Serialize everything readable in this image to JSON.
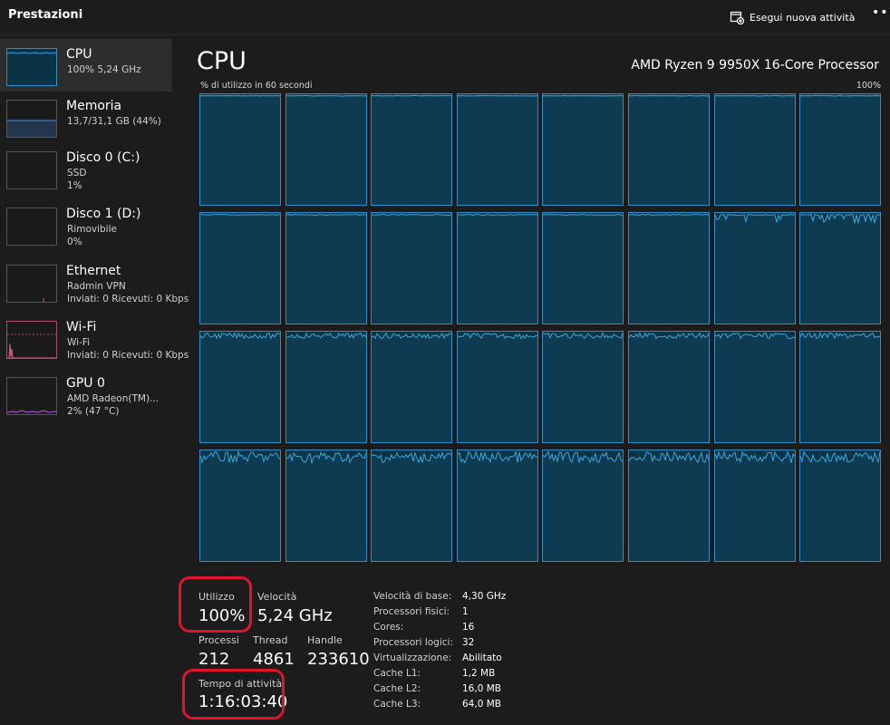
{
  "window": {
    "title": "Prestazioni",
    "run_task_label": "Esegui nuova attività",
    "more_label": "•••"
  },
  "sidebar": {
    "items": [
      {
        "name": "CPU",
        "sub1": "100% 5,24 GHz",
        "sub2": ""
      },
      {
        "name": "Memoria",
        "sub1": "13,7/31,1 GB (44%)",
        "sub2": ""
      },
      {
        "name": "Disco 0 (C:)",
        "sub1": "SSD",
        "sub2": "1%"
      },
      {
        "name": "Disco 1 (D:)",
        "sub1": "Rimovibile",
        "sub2": "0%"
      },
      {
        "name": "Ethernet",
        "sub1": "Radmin VPN",
        "sub2": "Inviati: 0 Ricevuti: 0 Kbps"
      },
      {
        "name": "Wi-Fi",
        "sub1": "Wi-Fi",
        "sub2": "Inviati: 0 Ricevuti: 0 Kbps"
      },
      {
        "name": "GPU 0",
        "sub1": "AMD Radeon(TM)...",
        "sub2": "2% (47 °C)"
      }
    ]
  },
  "main": {
    "title": "CPU",
    "processor": "AMD Ryzen 9 9950X 16-Core Processor",
    "graph_label": "% di utilizzo in 60 secondi",
    "graph_max": "100%"
  },
  "stats": {
    "utilization_label": "Utilizzo",
    "utilization_value": "100%",
    "speed_label": "Velocità",
    "speed_value": "5,24 GHz",
    "processes_label": "Processi",
    "processes_value": "212",
    "threads_label": "Thread",
    "threads_value": "4861",
    "handles_label": "Handle",
    "handles_value": "233610",
    "uptime_label": "Tempo di attività",
    "uptime_value": "1:16:03:40"
  },
  "details": [
    {
      "label": "Velocità di base:",
      "value": "4,30 GHz"
    },
    {
      "label": "Processori fisici:",
      "value": "1"
    },
    {
      "label": "Cores:",
      "value": "16"
    },
    {
      "label": "Processori logici:",
      "value": "32"
    },
    {
      "label": "Virtualizzazione:",
      "value": "Abilitato"
    },
    {
      "label": "Cache L1:",
      "value": "1,2 MB"
    },
    {
      "label": "Cache L2:",
      "value": "16,0 MB"
    },
    {
      "label": "Cache L3:",
      "value": "64,0 MB"
    }
  ],
  "colors": {
    "graph_line": "#3aa7dc",
    "graph_fill": "#0b3346",
    "highlight": "#e0142a",
    "memory": "#3a6ea5",
    "wifi": "#d35a8a",
    "gpu": "#a24cc2"
  }
}
